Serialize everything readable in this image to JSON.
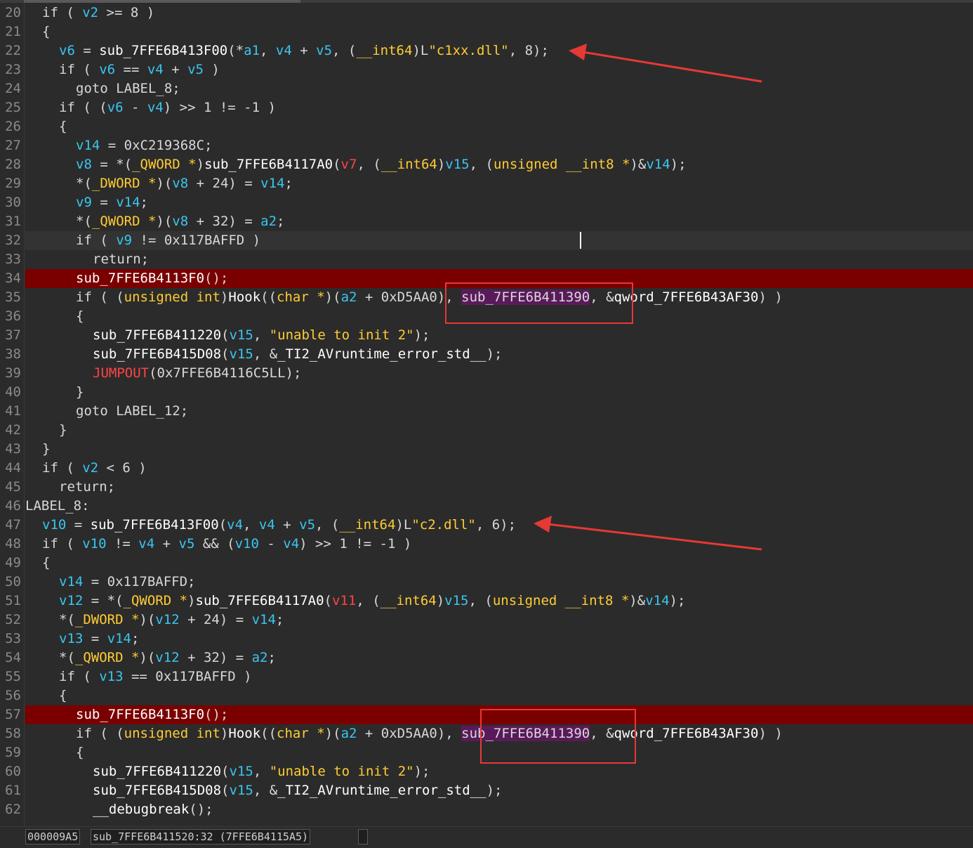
{
  "lines": [
    {
      "n": "20",
      "i": 1,
      "t": [
        [
          "kw",
          "if ( "
        ],
        [
          "v",
          "v2"
        ],
        [
          "kw",
          " >= 8 )"
        ]
      ]
    },
    {
      "n": "21",
      "i": 1,
      "t": [
        [
          "kw",
          "{"
        ]
      ]
    },
    {
      "n": "22",
      "i": 2,
      "t": [
        [
          "v",
          "v6"
        ],
        [
          "kw",
          " = "
        ],
        [
          "fn",
          "sub_7FFE6B413F00"
        ],
        [
          "kw",
          "(*"
        ],
        [
          "v",
          "a1"
        ],
        [
          "kw",
          ", "
        ],
        [
          "v",
          "v4"
        ],
        [
          "kw",
          " + "
        ],
        [
          "v",
          "v5"
        ],
        [
          "kw",
          ", ("
        ],
        [
          "ty",
          "__int64"
        ],
        [
          "kw",
          ")L"
        ],
        [
          "st",
          "\"c1xx.dll\""
        ],
        [
          "kw",
          ", 8);"
        ]
      ]
    },
    {
      "n": "23",
      "i": 2,
      "t": [
        [
          "kw",
          "if ( "
        ],
        [
          "v",
          "v6"
        ],
        [
          "kw",
          " == "
        ],
        [
          "v",
          "v4"
        ],
        [
          "kw",
          " + "
        ],
        [
          "v",
          "v5"
        ],
        [
          "kw",
          " )"
        ]
      ]
    },
    {
      "n": "24",
      "i": 3,
      "t": [
        [
          "kw",
          "goto LABEL_8;"
        ]
      ]
    },
    {
      "n": "25",
      "i": 2,
      "t": [
        [
          "kw",
          "if ( ("
        ],
        [
          "v",
          "v6"
        ],
        [
          "kw",
          " - "
        ],
        [
          "v",
          "v4"
        ],
        [
          "kw",
          ") >> 1 != -1 )"
        ]
      ]
    },
    {
      "n": "26",
      "i": 2,
      "t": [
        [
          "kw",
          "{"
        ]
      ]
    },
    {
      "n": "27",
      "i": 3,
      "t": [
        [
          "v",
          "v14"
        ],
        [
          "kw",
          " = 0xC219368C;"
        ]
      ]
    },
    {
      "n": "28",
      "i": 3,
      "t": [
        [
          "v",
          "v8"
        ],
        [
          "kw",
          " = *("
        ],
        [
          "ty",
          "_QWORD *"
        ],
        [
          "kw",
          ")"
        ],
        [
          "fn",
          "sub_7FFE6B4117A0"
        ],
        [
          "kw",
          "("
        ],
        [
          "red",
          "v7"
        ],
        [
          "kw",
          ", ("
        ],
        [
          "ty",
          "__int64"
        ],
        [
          "kw",
          ")"
        ],
        [
          "v",
          "v15"
        ],
        [
          "kw",
          ", ("
        ],
        [
          "ty",
          "unsigned __int8 *"
        ],
        [
          "kw",
          ")&"
        ],
        [
          "v",
          "v14"
        ],
        [
          "kw",
          ");"
        ]
      ]
    },
    {
      "n": "29",
      "i": 3,
      "t": [
        [
          "kw",
          "*("
        ],
        [
          "ty",
          "_DWORD *"
        ],
        [
          "kw",
          ")("
        ],
        [
          "v",
          "v8"
        ],
        [
          "kw",
          " + 24) = "
        ],
        [
          "v",
          "v14"
        ],
        [
          "kw",
          ";"
        ]
      ]
    },
    {
      "n": "30",
      "i": 3,
      "t": [
        [
          "v",
          "v9"
        ],
        [
          "kw",
          " = "
        ],
        [
          "v",
          "v14"
        ],
        [
          "kw",
          ";"
        ]
      ]
    },
    {
      "n": "31",
      "i": 3,
      "t": [
        [
          "kw",
          "*("
        ],
        [
          "ty",
          "_QWORD *"
        ],
        [
          "kw",
          ")("
        ],
        [
          "v",
          "v8"
        ],
        [
          "kw",
          " + 32) = "
        ],
        [
          "v",
          "a2"
        ],
        [
          "kw",
          ";"
        ]
      ]
    },
    {
      "n": "32",
      "i": 3,
      "cur": true,
      "t": [
        [
          "kw",
          "if ( "
        ],
        [
          "v",
          "v9"
        ],
        [
          "kw",
          " != 0x117BAFFD )"
        ]
      ]
    },
    {
      "n": "33",
      "i": 4,
      "t": [
        [
          "kw",
          "return;"
        ]
      ]
    },
    {
      "n": "34",
      "i": 3,
      "bp": true,
      "t": [
        [
          "fn",
          "sub_7FFE6B4113F0"
        ],
        [
          "kw",
          "();"
        ]
      ]
    },
    {
      "n": "35",
      "i": 3,
      "t": [
        [
          "kw",
          "if ( ("
        ],
        [
          "ty",
          "unsigned int"
        ],
        [
          "kw",
          ")"
        ],
        [
          "fn",
          "Hook"
        ],
        [
          "kw",
          "(("
        ],
        [
          "ty",
          "char *"
        ],
        [
          "kw",
          ")("
        ],
        [
          "v",
          "a2"
        ],
        [
          "kw",
          " + 0xD5AA0), "
        ],
        [
          "hl",
          "sub_7FFE6B411390"
        ],
        [
          "kw",
          ", &"
        ],
        [
          "fn",
          "qword_7FFE6B43AF30"
        ],
        [
          "kw",
          ") )"
        ]
      ]
    },
    {
      "n": "36",
      "i": 3,
      "t": [
        [
          "kw",
          "{"
        ]
      ]
    },
    {
      "n": "37",
      "i": 4,
      "t": [
        [
          "fn",
          "sub_7FFE6B411220"
        ],
        [
          "kw",
          "("
        ],
        [
          "v",
          "v15"
        ],
        [
          "kw",
          ", "
        ],
        [
          "st",
          "\"unable to init 2\""
        ],
        [
          "kw",
          ");"
        ]
      ]
    },
    {
      "n": "38",
      "i": 4,
      "t": [
        [
          "fn",
          "sub_7FFE6B415D08"
        ],
        [
          "kw",
          "("
        ],
        [
          "v",
          "v15"
        ],
        [
          "kw",
          ", &"
        ],
        [
          "fn",
          "_TI2_AVruntime_error_std__"
        ],
        [
          "kw",
          ");"
        ]
      ]
    },
    {
      "n": "39",
      "i": 4,
      "t": [
        [
          "red",
          "JUMPOUT"
        ],
        [
          "kw",
          "(0x7FFE6B4116C5LL);"
        ]
      ]
    },
    {
      "n": "40",
      "i": 3,
      "t": [
        [
          "kw",
          "}"
        ]
      ]
    },
    {
      "n": "41",
      "i": 3,
      "t": [
        [
          "kw",
          "goto LABEL_12;"
        ]
      ]
    },
    {
      "n": "42",
      "i": 2,
      "t": [
        [
          "kw",
          "}"
        ]
      ]
    },
    {
      "n": "43",
      "i": 1,
      "t": [
        [
          "kw",
          "}"
        ]
      ]
    },
    {
      "n": "44",
      "i": 1,
      "t": [
        [
          "kw",
          "if ( "
        ],
        [
          "v",
          "v2"
        ],
        [
          "kw",
          " < 6 )"
        ]
      ]
    },
    {
      "n": "45",
      "i": 2,
      "t": [
        [
          "kw",
          "return;"
        ]
      ]
    },
    {
      "n": "46",
      "i": 0,
      "t": [
        [
          "kw",
          "LABEL_8:"
        ]
      ]
    },
    {
      "n": "47",
      "i": 1,
      "t": [
        [
          "v",
          "v10"
        ],
        [
          "kw",
          " = "
        ],
        [
          "fn",
          "sub_7FFE6B413F00"
        ],
        [
          "kw",
          "("
        ],
        [
          "v",
          "v4"
        ],
        [
          "kw",
          ", "
        ],
        [
          "v",
          "v4"
        ],
        [
          "kw",
          " + "
        ],
        [
          "v",
          "v5"
        ],
        [
          "kw",
          ", ("
        ],
        [
          "ty",
          "__int64"
        ],
        [
          "kw",
          ")L"
        ],
        [
          "st",
          "\"c2.dll\""
        ],
        [
          "kw",
          ", 6);"
        ]
      ]
    },
    {
      "n": "48",
      "i": 1,
      "t": [
        [
          "kw",
          "if ( "
        ],
        [
          "v",
          "v10"
        ],
        [
          "kw",
          " != "
        ],
        [
          "v",
          "v4"
        ],
        [
          "kw",
          " + "
        ],
        [
          "v",
          "v5"
        ],
        [
          "kw",
          " && ("
        ],
        [
          "v",
          "v10"
        ],
        [
          "kw",
          " - "
        ],
        [
          "v",
          "v4"
        ],
        [
          "kw",
          ") >> 1 != -1 )"
        ]
      ]
    },
    {
      "n": "49",
      "i": 1,
      "t": [
        [
          "kw",
          "{"
        ]
      ]
    },
    {
      "n": "50",
      "i": 2,
      "t": [
        [
          "v",
          "v14"
        ],
        [
          "kw",
          " = 0x117BAFFD;"
        ]
      ]
    },
    {
      "n": "51",
      "i": 2,
      "t": [
        [
          "v",
          "v12"
        ],
        [
          "kw",
          " = *("
        ],
        [
          "ty",
          "_QWORD *"
        ],
        [
          "kw",
          ")"
        ],
        [
          "fn",
          "sub_7FFE6B4117A0"
        ],
        [
          "kw",
          "("
        ],
        [
          "red",
          "v11"
        ],
        [
          "kw",
          ", ("
        ],
        [
          "ty",
          "__int64"
        ],
        [
          "kw",
          ")"
        ],
        [
          "v",
          "v15"
        ],
        [
          "kw",
          ", ("
        ],
        [
          "ty",
          "unsigned __int8 *"
        ],
        [
          "kw",
          ")&"
        ],
        [
          "v",
          "v14"
        ],
        [
          "kw",
          ");"
        ]
      ]
    },
    {
      "n": "52",
      "i": 2,
      "t": [
        [
          "kw",
          "*("
        ],
        [
          "ty",
          "_DWORD *"
        ],
        [
          "kw",
          ")("
        ],
        [
          "v",
          "v12"
        ],
        [
          "kw",
          " + 24) = "
        ],
        [
          "v",
          "v14"
        ],
        [
          "kw",
          ";"
        ]
      ]
    },
    {
      "n": "53",
      "i": 2,
      "t": [
        [
          "v",
          "v13"
        ],
        [
          "kw",
          " = "
        ],
        [
          "v",
          "v14"
        ],
        [
          "kw",
          ";"
        ]
      ]
    },
    {
      "n": "54",
      "i": 2,
      "t": [
        [
          "kw",
          "*("
        ],
        [
          "ty",
          "_QWORD *"
        ],
        [
          "kw",
          ")("
        ],
        [
          "v",
          "v12"
        ],
        [
          "kw",
          " + 32) = "
        ],
        [
          "v",
          "a2"
        ],
        [
          "kw",
          ";"
        ]
      ]
    },
    {
      "n": "55",
      "i": 2,
      "t": [
        [
          "kw",
          "if ( "
        ],
        [
          "v",
          "v13"
        ],
        [
          "kw",
          " == 0x117BAFFD )"
        ]
      ]
    },
    {
      "n": "56",
      "i": 2,
      "t": [
        [
          "kw",
          "{"
        ]
      ]
    },
    {
      "n": "57",
      "i": 3,
      "bp": true,
      "t": [
        [
          "fn",
          "sub_7FFE6B4113F0"
        ],
        [
          "kw",
          "();"
        ]
      ]
    },
    {
      "n": "58",
      "i": 3,
      "t": [
        [
          "kw",
          "if ( ("
        ],
        [
          "ty",
          "unsigned int"
        ],
        [
          "kw",
          ")"
        ],
        [
          "fn",
          "Hook"
        ],
        [
          "kw",
          "(("
        ],
        [
          "ty",
          "char *"
        ],
        [
          "kw",
          ")("
        ],
        [
          "v",
          "a2"
        ],
        [
          "kw",
          " + 0xD5AA0), "
        ],
        [
          "hl",
          "sub_7FFE6B411390"
        ],
        [
          "kw",
          ", &"
        ],
        [
          "fn",
          "qword_7FFE6B43AF30"
        ],
        [
          "kw",
          ") )"
        ]
      ]
    },
    {
      "n": "59",
      "i": 3,
      "t": [
        [
          "kw",
          "{"
        ]
      ]
    },
    {
      "n": "60",
      "i": 4,
      "t": [
        [
          "fn",
          "sub_7FFE6B411220"
        ],
        [
          "kw",
          "("
        ],
        [
          "v",
          "v15"
        ],
        [
          "kw",
          ", "
        ],
        [
          "st",
          "\"unable to init 2\""
        ],
        [
          "kw",
          ");"
        ]
      ]
    },
    {
      "n": "61",
      "i": 4,
      "t": [
        [
          "fn",
          "sub_7FFE6B415D08"
        ],
        [
          "kw",
          "("
        ],
        [
          "v",
          "v15"
        ],
        [
          "kw",
          ", &"
        ],
        [
          "fn",
          "_TI2_AVruntime_error_std__"
        ],
        [
          "kw",
          ");"
        ]
      ]
    },
    {
      "n": "62",
      "i": 4,
      "t": [
        [
          "fn",
          "__debugbreak"
        ],
        [
          "kw",
          "();"
        ]
      ]
    }
  ],
  "status": {
    "offset": "000009A5",
    "location": "sub_7FFE6B411520:32 (7FFE6B4115A5)"
  },
  "colors": {
    "background": "#2b2b2b",
    "variable": "#39c6f0",
    "type_string": "#ffcc33",
    "breakpoint_line": "#7a0000",
    "annotation": "#e53935"
  }
}
